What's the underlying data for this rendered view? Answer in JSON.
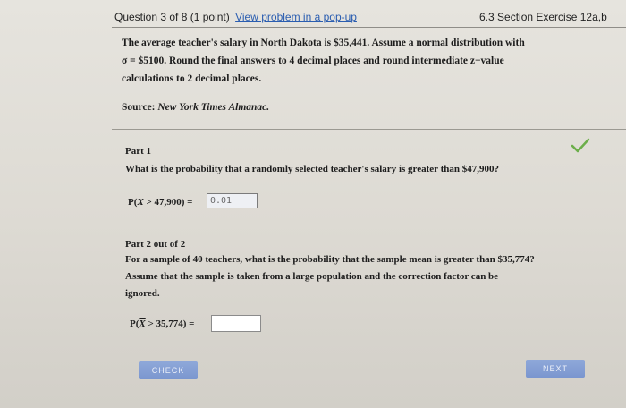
{
  "header": {
    "question_counter": "Question 3 of 8 (1 point)",
    "popup_link": "View problem in a pop-up",
    "section": "6.3 Section Exercise 12a,b"
  },
  "problem": {
    "line1": "The average teacher's salary in North Dakota is $35,441. Assume a normal distribution with",
    "line2": "σ = $5100. Round the final answers to 4 decimal places and round intermediate z−value",
    "line3": "calculations to 2 decimal places.",
    "source_label": "Source:",
    "source_name": "New York Times Almanac."
  },
  "part1": {
    "title": "Part 1",
    "question": "What is the probability that a randomly selected teacher's salary is greater than $47,900?",
    "expr_prefix": "P(",
    "expr_var": "X",
    "expr_suffix": " > 47,900) =",
    "answer": "0.01",
    "status_icon": "checkmark-icon",
    "status_color": "#6cae4a"
  },
  "part2": {
    "title": "Part 2 out of 2",
    "line1": "For a sample of 40 teachers, what is the probability that the sample mean is greater than $35,774?",
    "line2": "Assume that the sample is taken from a large population and the correction factor can be",
    "line3": "ignored.",
    "expr_prefix": "P(",
    "expr_var": "X",
    "expr_suffix": " > 35,774) =",
    "answer": ""
  },
  "buttons": {
    "check": "CHECK",
    "next": "NEXT"
  }
}
